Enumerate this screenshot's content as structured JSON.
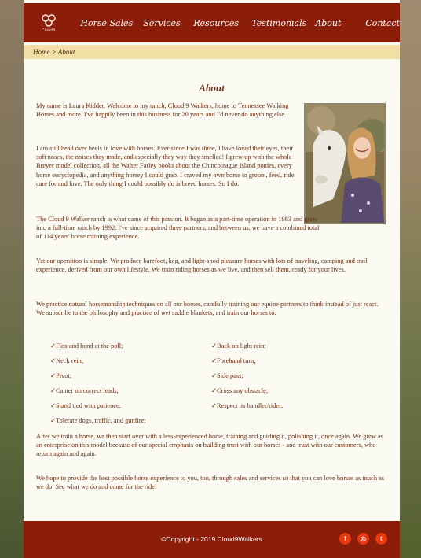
{
  "nav": {
    "logo_text": "Cloud9",
    "links": [
      "Horse Sales",
      "Services",
      "Resources",
      "Testimonials",
      "About",
      "Contact"
    ]
  },
  "breadcrumb": {
    "home": "Home",
    "separator": ">",
    "current": "About"
  },
  "page_title": "About",
  "paragraphs": [
    "My name is Laura Kidder. Welcome to my ranch, Cloud 9 Walkers, home to Tennessee Walking Horses and more. I've happily been in this business for 20 years and I'd never do anything else.",
    "I am still head over heels in love with horses. Ever since I was three, I have loved their eyes, their soft noses, the noises they made, and especially they way they smelled! I grew up with the whole Breyer model collection, all the Walter Farley books about the Chincoteague Island ponies, every horse encyclopedia, and anything horsey I could grab. I craved my own horse to groom, feed, ride, care for and love. The only thing I could possibly do is breed horses. So I do.",
    "The Cloud 9 Walker ranch is what came of this passion. It began as a part-time operation in 1983 and grew into a full-time ranch by 1992. I've since acquired three partners, and between us, we have a combined total of 114 years' horse training experience.",
    "Yet our operation is simple. We produce barefoot, keg, and light-shod pleasure horses with lots of traveling, camping and trail experience, derived from our own lifestyle. We train riding horses as we live, and then sell them, ready for your lives.",
    "We practice natural horsemanship techniques on all our horses, carefully training our equine partners to think instead of just react. We subscribe to the philosophy and practice of wet saddle blankets, and train our horses to:",
    "After we train a horse, we then start over with a less-experienced horse, training and guiding it, polishing it, once again. We grew as an enterprise on this model because of our special emphasis on building trust with our horses - and trust with our customers, who return again and again.",
    "We hope to provide the best possible horse experience to you, too, through sales and services so that you can love horses as much as we do. See what we do and come for the ride!"
  ],
  "checklist_mark": "✓",
  "checklist": [
    "Flex and bend at the poll;",
    "Back on light rein;",
    "Neck rein;",
    "Forehand turn;",
    "Pivot;",
    "Side pass;",
    "Canter on correct leads;",
    "Cross any obstacle;",
    "Stand tied with patience;",
    "Respect its handler/rider;",
    "Tolerate dogs, traffic, and gunfire;"
  ],
  "footer": {
    "copyright": "©Copyright - 2019 Cloud9Walkers",
    "social": [
      {
        "name": "facebook-icon",
        "glyph": "f"
      },
      {
        "name": "instagram-icon",
        "glyph": "◎"
      },
      {
        "name": "twitter-icon",
        "glyph": "t"
      }
    ]
  },
  "colors": {
    "brand": "#8c1d08",
    "crumb_bg": "#f1dfa4",
    "text": "#6a2e12",
    "social": "#e8380d"
  }
}
